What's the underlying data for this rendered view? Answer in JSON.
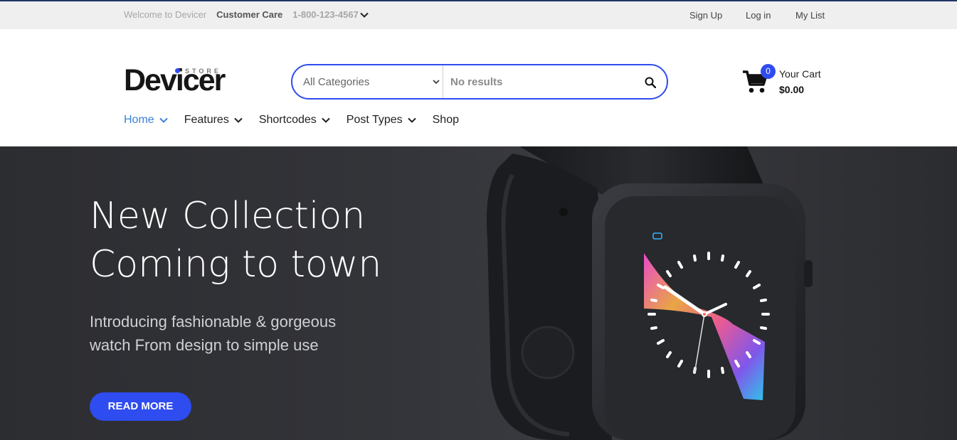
{
  "topbar": {
    "welcome": "Welcome to Devicer",
    "customer_care": "Customer Care",
    "phone": "1-800-123-4567",
    "sign_up": "Sign Up",
    "log_in": "Log in",
    "my_list": "My List"
  },
  "header": {
    "logo": "Devicer",
    "logo_tag": "STORE",
    "search": {
      "category": "All Categories",
      "query": "No results"
    },
    "cart": {
      "count": "0",
      "label": "Your Cart",
      "total": "$0.00"
    }
  },
  "nav": {
    "items": [
      {
        "label": "Home",
        "active": true
      },
      {
        "label": "Features"
      },
      {
        "label": "Shortcodes"
      },
      {
        "label": "Post Types"
      },
      {
        "label": "Shop"
      }
    ]
  },
  "hero": {
    "title_line1": "New Collection",
    "title_line2": "Coming to town",
    "subtitle_line1": "Introducing fashionable & gorgeous",
    "subtitle_line2": "watch From design to simple use",
    "button": "READ MORE"
  },
  "colors": {
    "accent": "#2f4cf0",
    "nav_active": "#3b82d6",
    "hero_bg": "#333439"
  }
}
